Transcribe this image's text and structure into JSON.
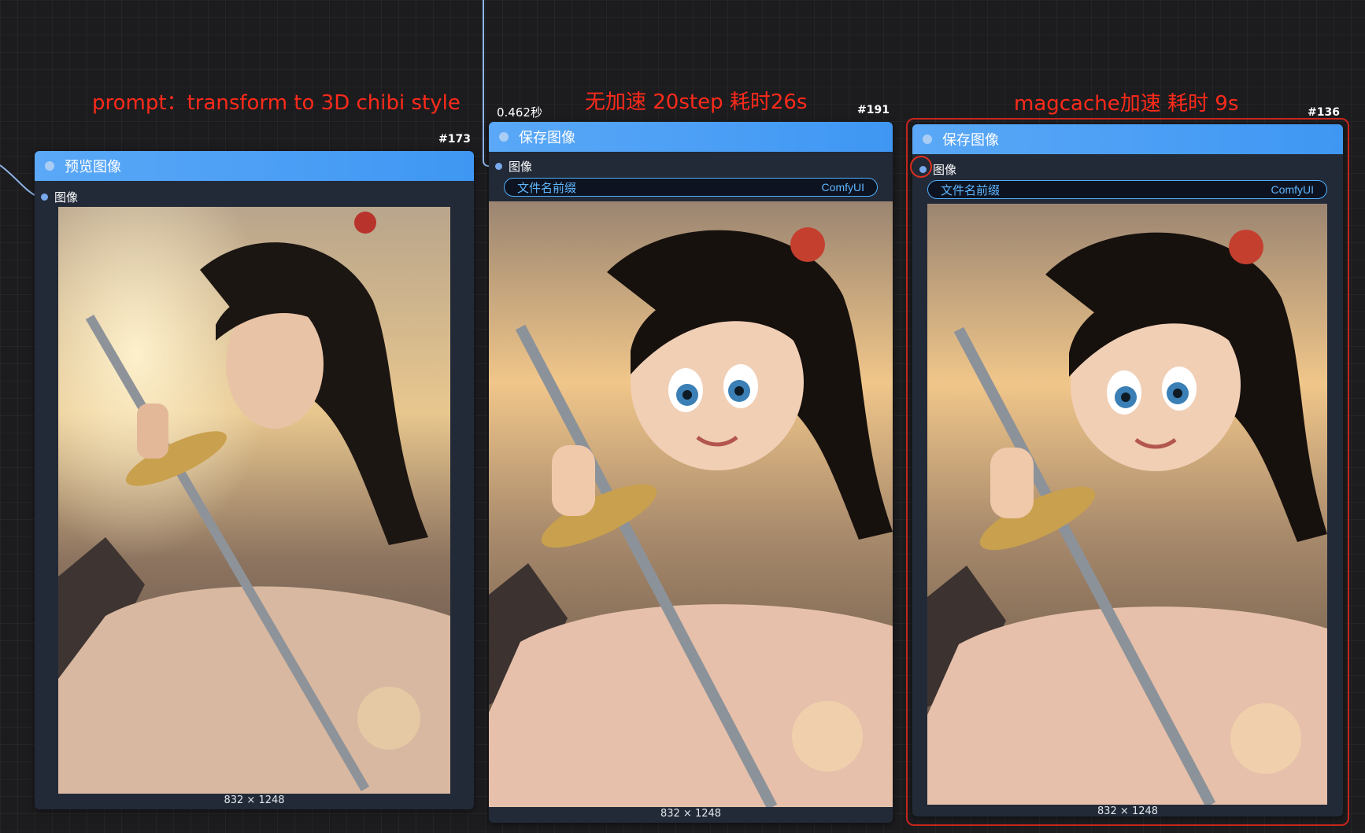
{
  "annotations": {
    "prompt": "prompt：transform to 3D chibi style",
    "no_accel": "无加速 20step 耗时26s",
    "magcache": "magcache加速 耗时 9s"
  },
  "nodes": {
    "preview": {
      "id": "#173",
      "title": "预览图像",
      "input_label": "图像",
      "image_size": "832 × 1248"
    },
    "save_a": {
      "id": "#191",
      "exec_time": "0.462秒",
      "title": "保存图像",
      "input_label": "图像",
      "widget_label": "文件名前缀",
      "widget_value": "ComfyUI",
      "image_size": "832 × 1248"
    },
    "save_b": {
      "id": "#136",
      "title": "保存图像",
      "input_label": "图像",
      "widget_label": "文件名前缀",
      "widget_value": "ComfyUI",
      "image_size": "832 × 1248"
    }
  },
  "colors": {
    "canvas_bg": "#1c1c1f",
    "node_body": "#222a38",
    "node_header": "#4a9ef5",
    "wire": "#8fb4e8",
    "annotation_text": "#ff2a1a",
    "widget_border": "#4fb0ff"
  }
}
